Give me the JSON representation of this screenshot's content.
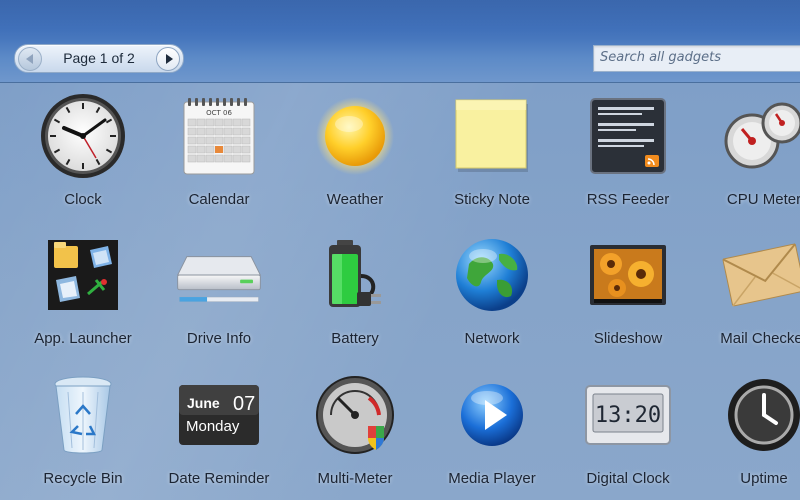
{
  "header": {
    "pager": {
      "prev_icon": "chevron-left-icon",
      "label": "Page 1 of 2",
      "next_icon": "chevron-right-icon"
    },
    "search": {
      "placeholder": "Search all gadgets",
      "value": ""
    }
  },
  "gadgets": [
    {
      "label": "Clock",
      "icon": "clock-icon"
    },
    {
      "label": "Calendar",
      "icon": "calendar-icon",
      "month": "OCT 06"
    },
    {
      "label": "Weather",
      "icon": "sun-icon"
    },
    {
      "label": "Sticky Note",
      "icon": "sticky-note-icon"
    },
    {
      "label": "RSS Feeder",
      "icon": "rss-icon"
    },
    {
      "label": "CPU Meter",
      "icon": "cpu-meter-icon"
    },
    {
      "label": "App. Launcher",
      "icon": "app-launcher-icon"
    },
    {
      "label": "Drive Info",
      "icon": "drive-icon"
    },
    {
      "label": "Battery",
      "icon": "battery-icon"
    },
    {
      "label": "Network",
      "icon": "globe-icon"
    },
    {
      "label": "Slideshow",
      "icon": "slideshow-icon"
    },
    {
      "label": "Mail Checker",
      "icon": "envelope-icon"
    },
    {
      "label": "Recycle Bin",
      "icon": "recycle-bin-icon"
    },
    {
      "label": "Date Reminder",
      "icon": "date-reminder-icon",
      "month": "June",
      "day": "07",
      "weekday": "Monday"
    },
    {
      "label": "Multi-Meter",
      "icon": "multi-meter-icon"
    },
    {
      "label": "Media Player",
      "icon": "play-icon"
    },
    {
      "label": "Digital Clock",
      "icon": "digital-clock-icon",
      "time": "13:20"
    },
    {
      "label": "Uptime",
      "icon": "uptime-icon"
    }
  ]
}
